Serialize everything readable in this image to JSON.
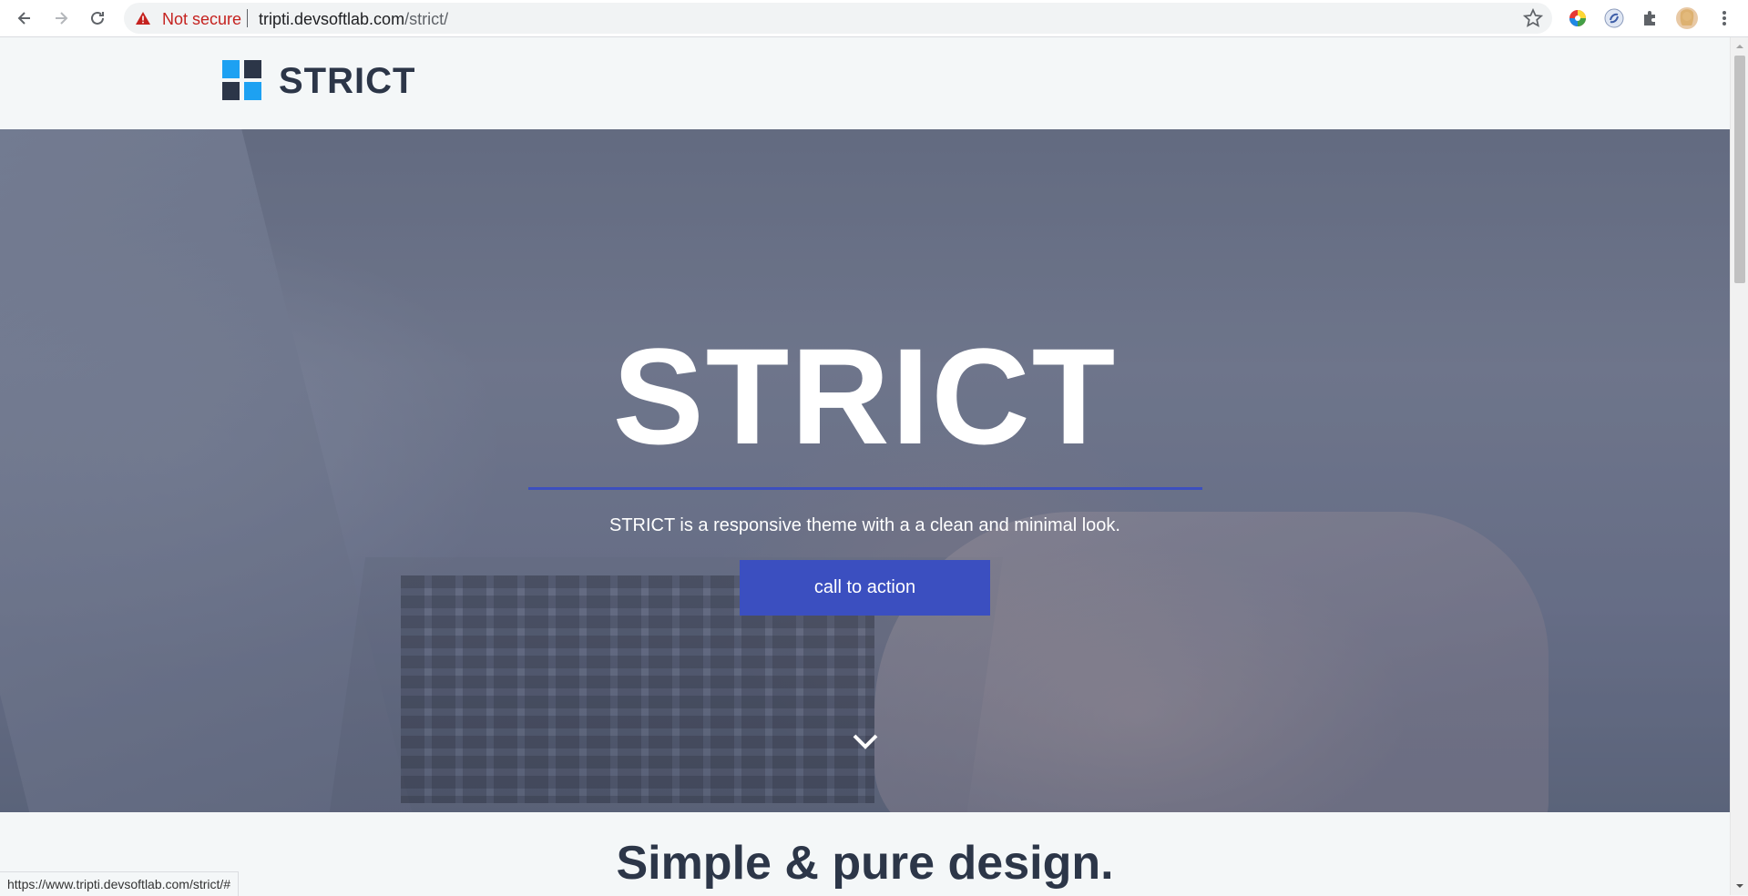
{
  "browser": {
    "security_label": "Not secure",
    "url_host": "tripti.devsoftlab.com",
    "url_path": "/strict/",
    "status_url": "https://www.tripti.devsoftlab.com/strict/#"
  },
  "site": {
    "logo_text": "STRICT",
    "logo_colors": [
      "#1da1f2",
      "#2c3648",
      "#2c3648",
      "#1da1f2"
    ]
  },
  "hero": {
    "title": "STRICT",
    "subtitle": "STRICT is a responsive theme with a a clean and minimal look.",
    "cta_label": "call to action",
    "accent_color": "#3b4fc0"
  },
  "section": {
    "title": "Simple & pure design."
  },
  "icons": {
    "back": "arrow-left-icon",
    "forward": "arrow-right-icon",
    "reload": "reload-icon",
    "warning": "warning-icon",
    "bookmark": "star-icon",
    "extensions": "puzzle-icon",
    "menu": "kebab-menu-icon",
    "scroll_down": "chevron-down-icon"
  }
}
